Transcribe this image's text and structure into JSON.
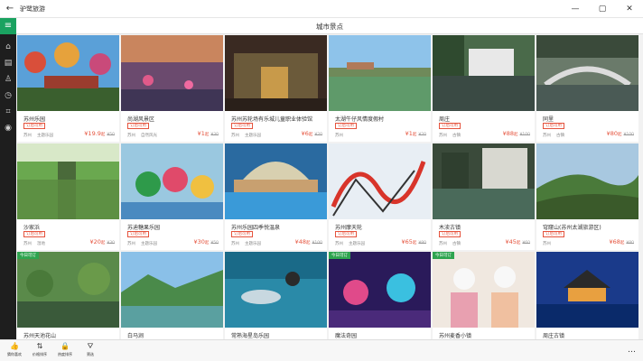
{
  "window": {
    "app_title": "驴鹭旅游",
    "back_icon": "back-arrow-icon",
    "minimize": "—",
    "maximize": "▢",
    "close": "✕"
  },
  "sidebar": {
    "menu_icon": "hamburger-icon",
    "items": [
      {
        "icon": "home-icon",
        "glyph": "⌂"
      },
      {
        "icon": "ticket-icon",
        "glyph": "▤"
      },
      {
        "icon": "user-icon",
        "glyph": "♙"
      },
      {
        "icon": "clock-icon",
        "glyph": "◷"
      },
      {
        "icon": "tag-icon",
        "glyph": "⌗"
      },
      {
        "icon": "circle-icon",
        "glyph": "◉"
      }
    ]
  },
  "header": {
    "title": "城市景点"
  },
  "cards": [
    {
      "name": "苏州乐园",
      "tag": "订后可用",
      "city": "苏州",
      "category": "主题乐园",
      "price": "¥19.9",
      "unit": "起",
      "orig": "¥50",
      "badge": ""
    },
    {
      "name": "尚湖风景区",
      "tag": "订后可用",
      "city": "苏州",
      "category": "自然风光",
      "price": "¥1",
      "unit": "起",
      "orig": "¥30",
      "badge": ""
    },
    {
      "name": "苏州苏轮场有乐城儿童职业体验馆",
      "tag": "订后可用",
      "city": "苏州",
      "category": "主题乐园",
      "price": "¥6",
      "unit": "起",
      "orig": "¥20",
      "badge": ""
    },
    {
      "name": "太湖牛仔风情度假村",
      "tag": "订后可用",
      "city": "苏州",
      "category": "",
      "price": "¥1",
      "unit": "起",
      "orig": "¥20",
      "badge": ""
    },
    {
      "name": "周庄",
      "tag": "订后可用",
      "city": "苏州",
      "category": "古镇",
      "price": "¥88",
      "unit": "起",
      "orig": "¥100",
      "badge": ""
    },
    {
      "name": "同里",
      "tag": "订后可用",
      "city": "苏州",
      "category": "古镇",
      "price": "¥80",
      "unit": "起",
      "orig": "¥100",
      "badge": ""
    },
    {
      "name": "沙家浜",
      "tag": "订后可用",
      "city": "苏州",
      "category": "湿地",
      "price": "¥20",
      "unit": "起",
      "orig": "¥30",
      "badge": ""
    },
    {
      "name": "苏迪糖果乐园",
      "tag": "订后可用",
      "city": "苏州",
      "category": "主题乐园",
      "price": "¥30",
      "unit": "起",
      "orig": "¥50",
      "badge": ""
    },
    {
      "name": "苏州乐园四季悦温泉",
      "tag": "订后可用",
      "city": "苏州",
      "category": "主题乐园",
      "price": "¥48",
      "unit": "起",
      "orig": "¥100",
      "badge": ""
    },
    {
      "name": "苏州摩天轮",
      "tag": "订后可用",
      "city": "苏州",
      "category": "主题乐园",
      "price": "¥65",
      "unit": "起",
      "orig": "¥80",
      "badge": ""
    },
    {
      "name": "木渎古镇",
      "tag": "订后可用",
      "city": "苏州",
      "category": "古镇",
      "price": "¥45",
      "unit": "起",
      "orig": "¥60",
      "badge": ""
    },
    {
      "name": "穹窿山(苏州太湖旅游区)",
      "tag": "订后可用",
      "city": "苏州",
      "category": "",
      "price": "¥68",
      "unit": "起",
      "orig": "¥80",
      "badge": ""
    },
    {
      "name": "苏州天池花山",
      "tag": "",
      "city": "",
      "category": "",
      "price": "",
      "unit": "",
      "orig": "",
      "badge": "今日可订"
    },
    {
      "name": "白马涧",
      "tag": "",
      "city": "",
      "category": "",
      "price": "",
      "unit": "",
      "orig": "",
      "badge": ""
    },
    {
      "name": "常熟海星岛乐园",
      "tag": "",
      "city": "",
      "category": "",
      "price": "",
      "unit": "",
      "orig": "",
      "badge": ""
    },
    {
      "name": "魔法奇园",
      "tag": "",
      "city": "",
      "category": "",
      "price": "",
      "unit": "",
      "orig": "",
      "badge": "今日可订"
    },
    {
      "name": "苏州麦香小镇",
      "tag": "",
      "city": "",
      "category": "",
      "price": "",
      "unit": "",
      "orig": "",
      "badge": "今日可订"
    },
    {
      "name": "周庄古镇",
      "tag": "",
      "city": "",
      "category": "",
      "price": "",
      "unit": "",
      "orig": "",
      "badge": ""
    }
  ],
  "bottom_bar": [
    {
      "icon": "thumbs-up-icon",
      "glyph": "👍",
      "label": "猜你喜欢"
    },
    {
      "icon": "sort-icon",
      "glyph": "⇅",
      "label": "价格排序"
    },
    {
      "icon": "lock-icon",
      "glyph": "🔒",
      "label": "热度排序"
    },
    {
      "icon": "filter-icon",
      "glyph": "⛛",
      "label": "筛选"
    }
  ],
  "more_icon": "more-icon"
}
